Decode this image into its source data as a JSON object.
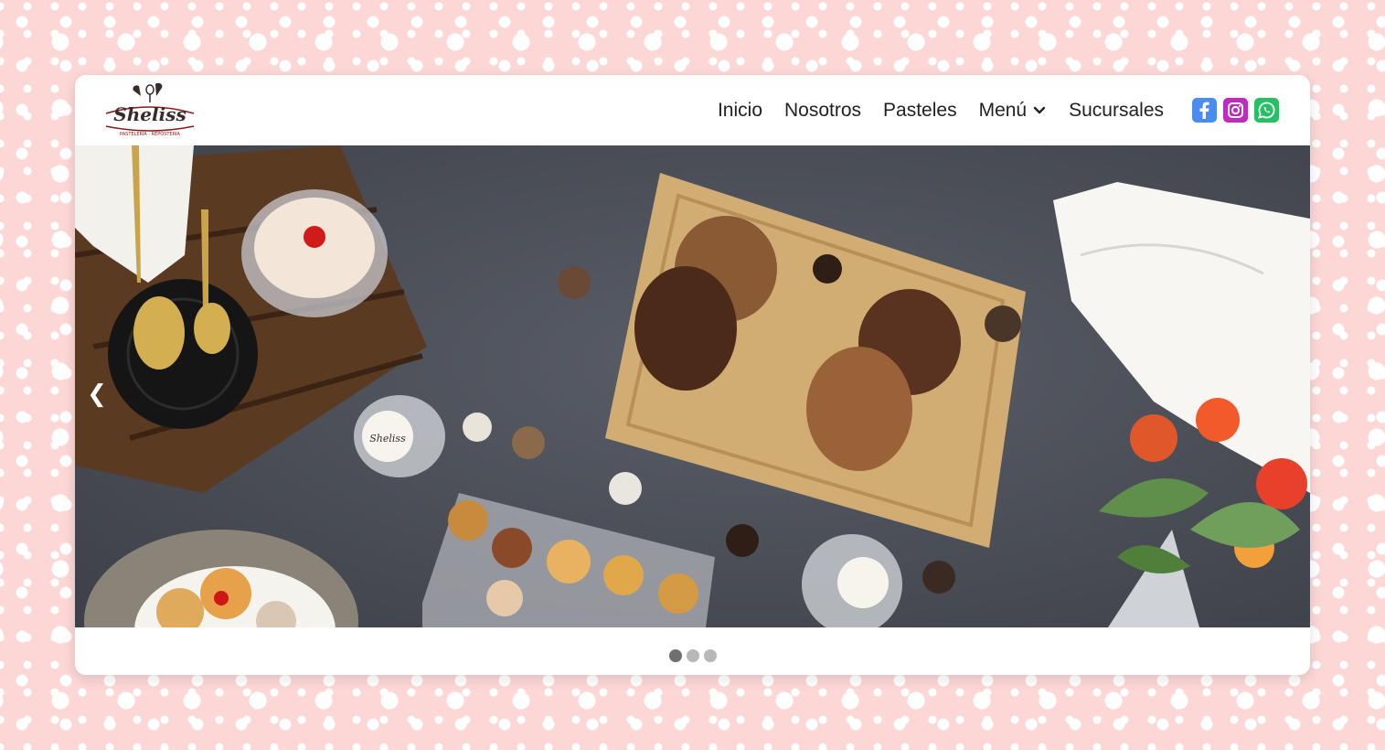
{
  "brand": {
    "logo_text": "Sheliss",
    "logo_subtext": "PASTELERÍA · REPOSTERÍA"
  },
  "nav": {
    "items": [
      {
        "label": "Inicio"
      },
      {
        "label": "Nosotros"
      },
      {
        "label": "Pasteles"
      },
      {
        "label": "Menú"
      },
      {
        "label": "Sucursales"
      }
    ]
  },
  "socials": [
    {
      "name": "facebook-icon",
      "color": "#4a8cf0"
    },
    {
      "name": "instagram-icon",
      "color": "#c02bbd"
    },
    {
      "name": "whatsapp-icon",
      "color": "#25c064"
    }
  ],
  "carousel": {
    "prev_label": "❮",
    "slide_count": 3,
    "active_index": 0,
    "jar_label": "Sheliss"
  },
  "colors": {
    "page_background": "#fdd6d6",
    "hero_background": "#4a4e56",
    "dot_active": "#6f6f6f",
    "dot_inactive": "#b8b8b8"
  }
}
